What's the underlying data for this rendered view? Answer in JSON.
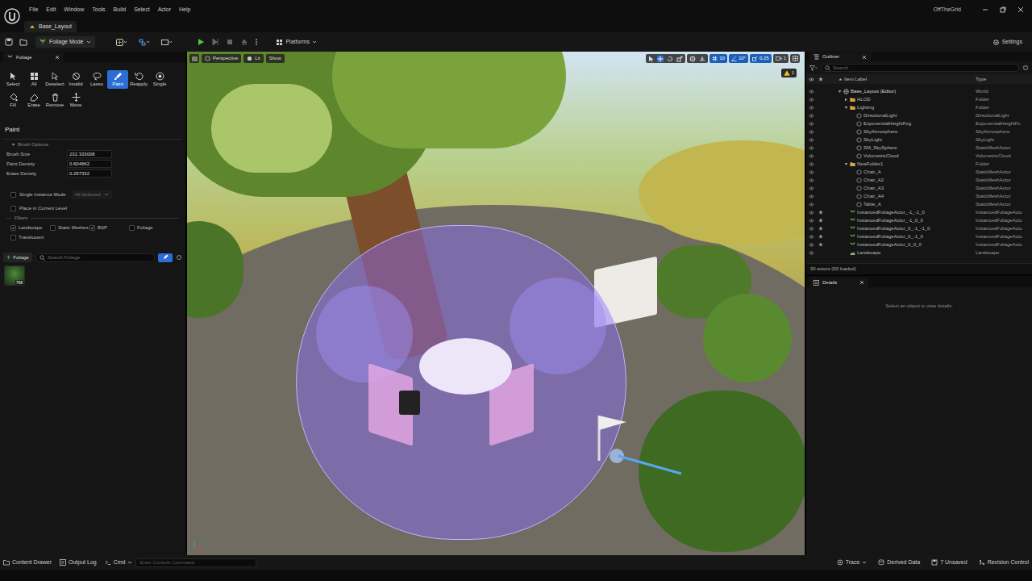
{
  "app": {
    "name": "OffTheGrid"
  },
  "menu": [
    "File",
    "Edit",
    "Window",
    "Tools",
    "Build",
    "Select",
    "Actor",
    "Help"
  ],
  "document_tab": {
    "label": "Base_Layout",
    "selected": true
  },
  "toolbar": {
    "mode": "Foliage Mode",
    "platforms": "Platforms",
    "settings": "Settings"
  },
  "foliage_panel": {
    "tab": "Foliage",
    "tools": [
      {
        "label": "Select",
        "selected": false
      },
      {
        "label": "All",
        "selected": false
      },
      {
        "label": "Deselect",
        "selected": false
      },
      {
        "label": "Invalid",
        "selected": false
      },
      {
        "label": "Lasso",
        "selected": false
      },
      {
        "label": "Paint",
        "selected": true
      },
      {
        "label": "Reapply",
        "selected": false
      },
      {
        "label": "Single",
        "selected": false
      },
      {
        "label": "Fill",
        "selected": false
      },
      {
        "label": "Erase",
        "selected": false
      },
      {
        "label": "Remove",
        "selected": false
      },
      {
        "label": "Move",
        "selected": false
      }
    ],
    "section": "Paint",
    "brush_options": "Brush Options",
    "fields": [
      {
        "label": "Brush Size",
        "value": "232.333008"
      },
      {
        "label": "Paint Density",
        "value": "0.604662"
      },
      {
        "label": "Erase Density",
        "value": "0.297332"
      }
    ],
    "single_instance": {
      "label": "Single Instance Mode",
      "checked": false,
      "mode": "All Selected",
      "disabled": true
    },
    "place_in_level": {
      "label": "Place in Current Level",
      "checked": false
    },
    "filters_title": "Filters",
    "filters": [
      {
        "label": "Landscape",
        "checked": true
      },
      {
        "label": "Static Meshes",
        "checked": false
      },
      {
        "label": "BSP",
        "checked": true
      },
      {
        "label": "Foliage",
        "checked": false
      },
      {
        "label": "Translucent",
        "checked": false
      }
    ],
    "add_button": {
      "icon": "+",
      "label": "Foliage"
    },
    "search": {
      "placeholder": "Search Foliage"
    },
    "items": [
      {
        "count": "768",
        "selected": false
      }
    ]
  },
  "viewport": {
    "view": "Perspective",
    "lighting": "Lit",
    "show": "Show",
    "grid_snap": {
      "value": "10",
      "on": true
    },
    "rotation_snap": {
      "value": "10°",
      "on": true
    },
    "scale_snap": {
      "value": "0.25",
      "on": true
    },
    "camera_speed": "1",
    "warnings": "1"
  },
  "outliner": {
    "tab": "Outliner",
    "search": {
      "placeholder": "Search"
    },
    "columns": [
      "Item Label",
      "Type"
    ],
    "rows": [
      {
        "label": "Base_Layout (Editor)",
        "type": "World",
        "depth": 0,
        "kind": "world",
        "expanded": true,
        "marked": false
      },
      {
        "label": "HLOD",
        "type": "Folder",
        "depth": 1,
        "kind": "folder",
        "expanded": false,
        "marked": false
      },
      {
        "label": "Lighting",
        "type": "Folder",
        "depth": 1,
        "kind": "folder",
        "expanded": true,
        "marked": false
      },
      {
        "label": "DirectionalLight",
        "type": "DirectionalLight",
        "depth": 2,
        "kind": "actor",
        "expanded": false,
        "marked": false
      },
      {
        "label": "ExponentialHeightFog",
        "type": "ExponentialHeightFo",
        "depth": 2,
        "kind": "actor",
        "expanded": false,
        "marked": false
      },
      {
        "label": "SkyAtmosphere",
        "type": "SkyAtmosphere",
        "depth": 2,
        "kind": "actor",
        "expanded": false,
        "marked": false
      },
      {
        "label": "SkyLight",
        "type": "SkyLight",
        "depth": 2,
        "kind": "actor",
        "expanded": false,
        "marked": false
      },
      {
        "label": "SM_SkySphere",
        "type": "StaticMeshActor",
        "depth": 2,
        "kind": "actor",
        "expanded": false,
        "marked": false
      },
      {
        "label": "VolumetricCloud",
        "type": "VolumetricCloud",
        "depth": 2,
        "kind": "actor",
        "expanded": false,
        "marked": false
      },
      {
        "label": "NewFolder1",
        "type": "Folder",
        "depth": 1,
        "kind": "folder",
        "expanded": true,
        "marked": false
      },
      {
        "label": "Chair_A",
        "type": "StaticMeshActor",
        "depth": 2,
        "kind": "actor",
        "expanded": false,
        "marked": false
      },
      {
        "label": "Chair_A2",
        "type": "StaticMeshActor",
        "depth": 2,
        "kind": "actor",
        "expanded": false,
        "marked": false
      },
      {
        "label": "Chair_A3",
        "type": "StaticMeshActor",
        "depth": 2,
        "kind": "actor",
        "expanded": false,
        "marked": false
      },
      {
        "label": "Chair_A4",
        "type": "StaticMeshActor",
        "depth": 2,
        "kind": "actor",
        "expanded": false,
        "marked": false
      },
      {
        "label": "Table_A",
        "type": "StaticMeshActor",
        "depth": 2,
        "kind": "actor",
        "expanded": false,
        "marked": false
      },
      {
        "label": "InstancedFoliageActor_-1_-1_0",
        "type": "InstancedFoliageActo",
        "depth": 1,
        "kind": "foliage",
        "expanded": false,
        "marked": true
      },
      {
        "label": "InstancedFoliageActor_-1_0_0",
        "type": "InstancedFoliageActo",
        "depth": 1,
        "kind": "foliage",
        "expanded": false,
        "marked": true
      },
      {
        "label": "InstancedFoliageActor_0_-1_-1_0",
        "type": "InstancedFoliageActo",
        "depth": 1,
        "kind": "foliage",
        "expanded": false,
        "marked": true
      },
      {
        "label": "InstancedFoliageActor_0_-1_0",
        "type": "InstancedFoliageActo",
        "depth": 1,
        "kind": "foliage",
        "expanded": false,
        "marked": true
      },
      {
        "label": "InstancedFoliageActor_0_0_0",
        "type": "InstancedFoliageActo",
        "depth": 1,
        "kind": "foliage",
        "expanded": false,
        "marked": true
      },
      {
        "label": "Landscape",
        "type": "Landscape",
        "depth": 1,
        "kind": "landscape",
        "expanded": false,
        "marked": false
      }
    ],
    "footer": "90 actors (90 loaded)"
  },
  "details": {
    "tab": "Details",
    "empty": "Select an object to view details."
  },
  "status_bar": {
    "left": [
      "Content Drawer",
      "Output Log",
      "Cmd"
    ],
    "console": {
      "placeholder": "Enter Console Command"
    },
    "right": [
      "Trace",
      "Derived Data",
      "7 Unsaved",
      "Revision Control"
    ]
  }
}
